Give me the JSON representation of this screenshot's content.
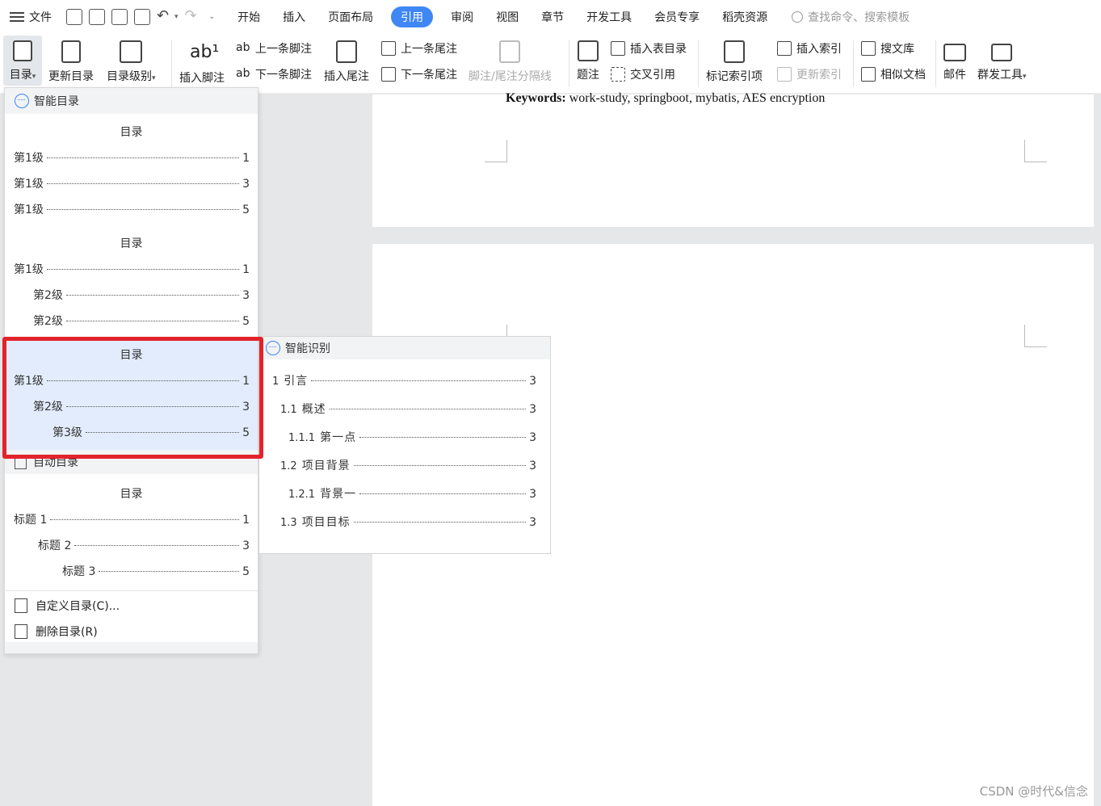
{
  "menubar": {
    "file_label": "文件",
    "tabs": [
      "开始",
      "插入",
      "页面布局",
      "引用",
      "审阅",
      "视图",
      "章节",
      "开发工具",
      "会员专享",
      "稻壳资源"
    ],
    "active_tab": "引用",
    "search_placeholder": "查找命令、搜索模板"
  },
  "ribbon": {
    "toc": "目录",
    "update_toc": "更新目录",
    "toc_level": "目录级别",
    "insert_footnote": "插入脚注",
    "prev_footnote": "上一条脚注",
    "next_footnote": "下一条脚注",
    "insert_endnote": "插入尾注",
    "prev_endnote": "上一条尾注",
    "next_endnote": "下一条尾注",
    "note_separator": "脚注/尾注分隔线",
    "caption": "题注",
    "insert_figure_toc": "插入表目录",
    "cross_ref": "交叉引用",
    "mark_index": "标记索引项",
    "insert_index": "插入索引",
    "update_index": "更新索引",
    "search_library": "搜文库",
    "similar_docs": "相似文档",
    "mail": "邮件",
    "group_tools": "群发工具"
  },
  "document": {
    "keywords_label": "Keywords:",
    "keywords_value": " work-study, springboot, mybatis, AES encryption",
    "watermark": "CSDN @时代&信念"
  },
  "toc_menu": {
    "smart_toc_header": "智能目录",
    "presets": [
      {
        "title": "目录",
        "lines": [
          {
            "text": "第1级",
            "page": "1"
          },
          {
            "text": "第1级",
            "page": "3"
          },
          {
            "text": "第1级",
            "page": "5"
          }
        ]
      },
      {
        "title": "目录",
        "lines": [
          {
            "text": "第1级",
            "page": "1"
          },
          {
            "text": "第2级",
            "page": "3"
          },
          {
            "text": "第2级",
            "page": "5"
          }
        ]
      },
      {
        "title": "目录",
        "lines": [
          {
            "text": "第1级",
            "page": "1"
          },
          {
            "text": "第2级",
            "page": "3"
          },
          {
            "text": "第3级",
            "page": "5"
          }
        ]
      }
    ],
    "auto_toc_header": "自动目录",
    "auto_preset": {
      "title": "目录",
      "lines": [
        {
          "text": "标题 1",
          "page": "1"
        },
        {
          "text": "标题 2",
          "page": "3"
        },
        {
          "text": "标题 3",
          "page": "5"
        }
      ]
    },
    "custom_toc": "自定义目录(C)...",
    "delete_toc": "删除目录(R)"
  },
  "smart_submenu": {
    "header": "智能识别",
    "lines": [
      {
        "num": "1",
        "text": "引言",
        "page": "3"
      },
      {
        "num": "1.1",
        "text": "概述",
        "page": "3"
      },
      {
        "num": "1.1.1",
        "text": "第一点",
        "page": "3"
      },
      {
        "num": "1.2",
        "text": "项目背景",
        "page": "3"
      },
      {
        "num": "1.2.1",
        "text": "背景一",
        "page": "3"
      },
      {
        "num": "1.3",
        "text": "项目目标",
        "page": "3"
      }
    ]
  },
  "colors": {
    "accent": "#3e87f5",
    "highlight": "#e2ecfc",
    "annotation_red": "#e3232b"
  }
}
